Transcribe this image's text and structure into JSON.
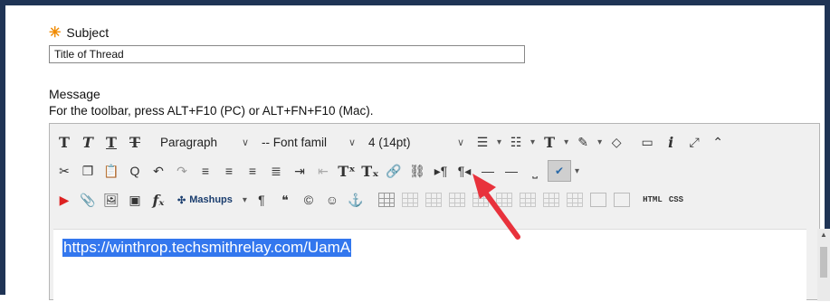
{
  "subject": {
    "label": "Subject",
    "required_mark": "✳",
    "value": "Title of Thread"
  },
  "message": {
    "label": "Message",
    "help": "For the toolbar, press ALT+F10 (PC) or ALT+FN+F10 (Mac)."
  },
  "toolbar": {
    "paragraph": "Paragraph",
    "font_family": "-- Font famil",
    "font_size": "4 (14pt)",
    "mashups": "Mashups",
    "html": "HTML",
    "css": "CSS"
  },
  "editor": {
    "content": "https://winthrop.techsmithrelay.com/UamA"
  },
  "colors": {
    "frame": "#1f3455",
    "required": "#f08a00",
    "selection": "#3377ee",
    "arrow": "#e8323c"
  }
}
